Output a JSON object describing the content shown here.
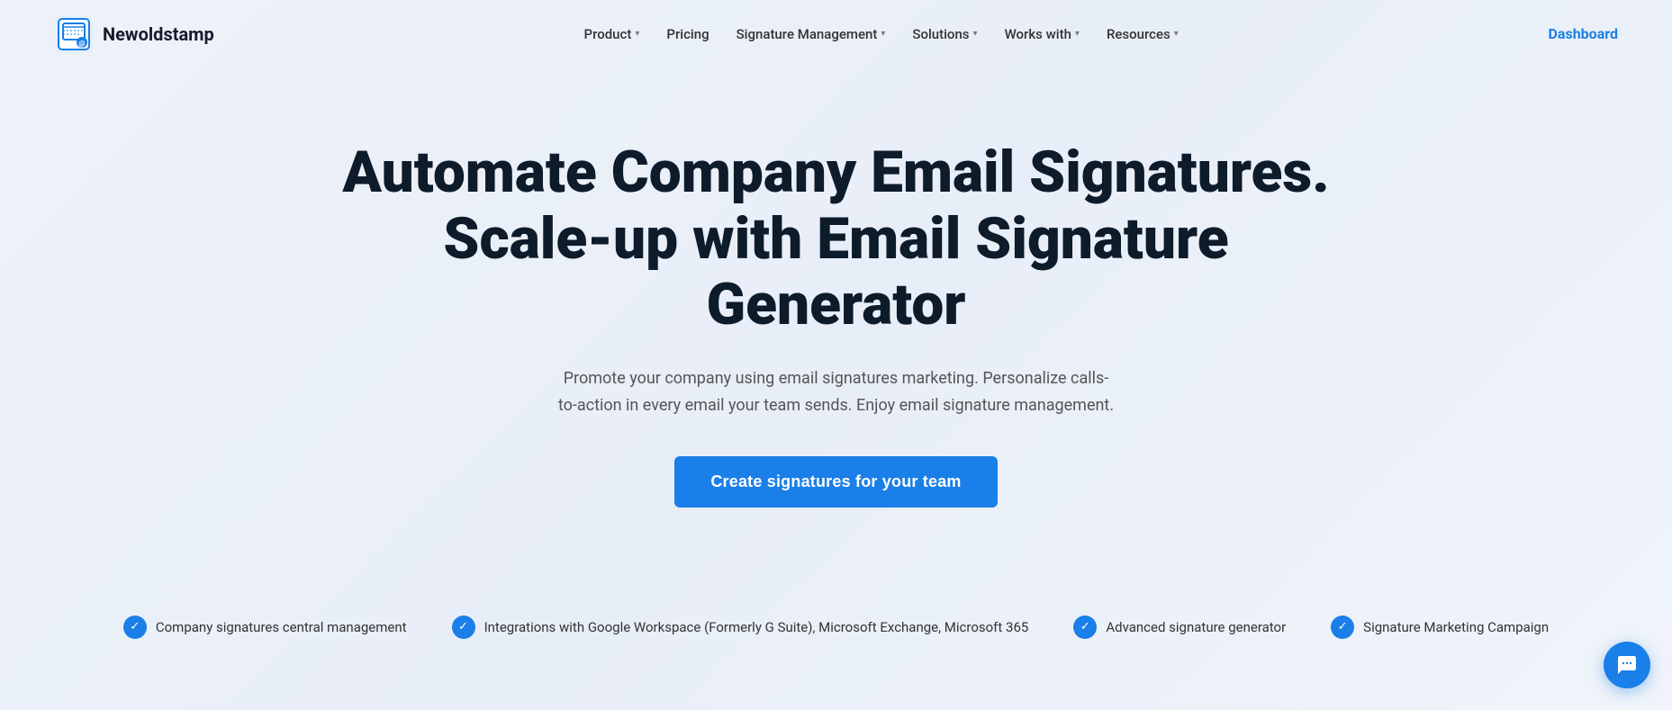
{
  "logo": {
    "text": "Newoldstamp"
  },
  "nav": {
    "items": [
      {
        "label": "Product",
        "hasDropdown": true
      },
      {
        "label": "Pricing",
        "hasDropdown": false
      },
      {
        "label": "Signature Management",
        "hasDropdown": true
      },
      {
        "label": "Solutions",
        "hasDropdown": true
      },
      {
        "label": "Works with",
        "hasDropdown": true
      },
      {
        "label": "Resources",
        "hasDropdown": true
      }
    ],
    "dashboard_label": "Dashboard"
  },
  "hero": {
    "title_line1": "Automate Company Email Signatures.",
    "title_line2": "Scale-up with Email Signature Generator",
    "subtitle": "Promote your company using email signatures marketing. Personalize calls-to-action in every email your team sends. Enjoy email signature management.",
    "cta_label": "Create signatures for your team"
  },
  "features": [
    {
      "label": "Company signatures central management"
    },
    {
      "label": "Integrations with Google Workspace (Formerly G Suite), Microsoft Exchange, Microsoft 365"
    },
    {
      "label": "Advanced signature generator"
    },
    {
      "label": "Signature Marketing Campaign"
    }
  ],
  "colors": {
    "accent": "#1a7fe8",
    "text_dark": "#0d1b2a",
    "text_muted": "#555555"
  }
}
